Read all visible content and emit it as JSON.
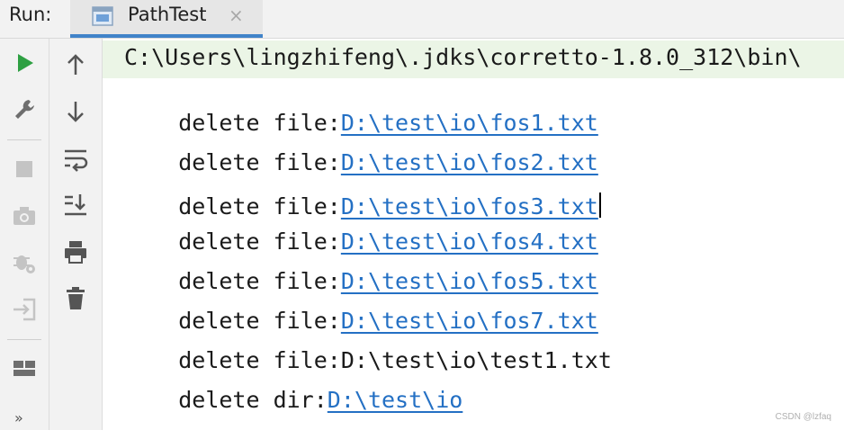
{
  "run_label": "Run:",
  "tab": {
    "title": "PathTest",
    "close": "×"
  },
  "colors": {
    "run_green": "#2ea043",
    "link_blue": "#2470c4",
    "cmd_highlight": "#ebf5e6",
    "tab_underline": "#4083c9"
  },
  "toolbar_left": [
    {
      "icon": "run-icon"
    },
    {
      "icon": "wrench-icon"
    },
    {
      "icon": "stop-icon"
    },
    {
      "icon": "camera-icon"
    },
    {
      "icon": "debug-gear-icon"
    },
    {
      "icon": "login-exit-icon"
    },
    {
      "icon": "layout-icon"
    }
  ],
  "more_label": "»",
  "toolbar_right": [
    {
      "icon": "arrow-up-icon"
    },
    {
      "icon": "arrow-down-icon"
    },
    {
      "icon": "soft-wrap-icon"
    },
    {
      "icon": "scroll-to-end-icon"
    },
    {
      "icon": "print-icon"
    },
    {
      "icon": "trash-icon"
    }
  ],
  "console": {
    "command": "C:\\Users\\lingzhifeng\\.jdks\\corretto-1.8.0_312\\bin\\",
    "lines": [
      {
        "prefix": "delete file:",
        "path": "D:\\test\\io\\fos1.txt",
        "link": true
      },
      {
        "prefix": "delete file:",
        "path": "D:\\test\\io\\fos2.txt",
        "link": true
      },
      {
        "prefix": "delete file:",
        "path": "D:\\test\\io\\fos3.txt",
        "link": true
      },
      {
        "prefix": "delete file:",
        "path": "D:\\test\\io\\fos4.txt",
        "link": true
      },
      {
        "prefix": "delete file:",
        "path": "D:\\test\\io\\fos5.txt",
        "link": true
      },
      {
        "prefix": "delete file:",
        "path": "D:\\test\\io\\fos7.txt",
        "link": true
      },
      {
        "prefix": "delete file:",
        "path": "D:\\test\\io\\test1.txt",
        "link": false
      },
      {
        "prefix": "delete dir:",
        "path": "D:\\test\\io",
        "link": true
      }
    ]
  },
  "watermark": "CSDN @lzfaq"
}
